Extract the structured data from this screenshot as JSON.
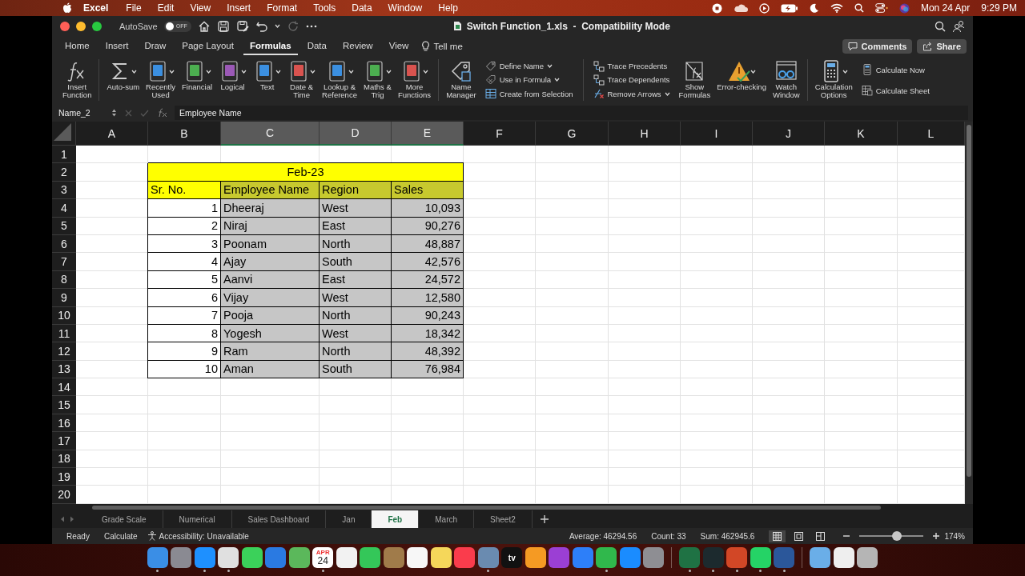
{
  "menu_bar": {
    "app": "Excel",
    "items": [
      "File",
      "Edit",
      "View",
      "Insert",
      "Format",
      "Tools",
      "Data",
      "Window",
      "Help"
    ],
    "date": "Mon 24 Apr",
    "time": "9:29 PM"
  },
  "title_bar": {
    "autosave_label": "AutoSave",
    "autosave": {
      "on": false,
      "label": "OFF"
    },
    "title": "Switch Function_1.xls  -  Compatibility Mode"
  },
  "tabs": [
    {
      "label": "Home",
      "selected": false
    },
    {
      "label": "Insert",
      "selected": false
    },
    {
      "label": "Draw",
      "selected": false
    },
    {
      "label": "Page Layout",
      "selected": false
    },
    {
      "label": "Formulas",
      "selected": true
    },
    {
      "label": "Data",
      "selected": false
    },
    {
      "label": "Review",
      "selected": false
    },
    {
      "label": "View",
      "selected": false
    }
  ],
  "tell_me": "Tell me",
  "share_buttons": [
    {
      "kind": "comments",
      "label": "Comments"
    },
    {
      "kind": "share",
      "label": "Share"
    }
  ],
  "ribbon": {
    "groups": [
      {
        "columns": [
          [
            {
              "kind": "function",
              "label": "Insert\nFunction",
              "dropdown": false
            }
          ]
        ]
      },
      {
        "columns": [
          [
            {
              "kind": "sigma",
              "label": "Auto-sum",
              "dropdown": true
            }
          ],
          [
            {
              "kind": "book",
              "color": "#3b8fe0",
              "label": "Recently\nUsed",
              "dropdown": true
            }
          ],
          [
            {
              "kind": "book",
              "color": "#4caf50",
              "label": "Financial",
              "dropdown": true
            }
          ],
          [
            {
              "kind": "book",
              "color": "#9b59b6",
              "label": "Logical",
              "dropdown": true
            }
          ],
          [
            {
              "kind": "book",
              "color": "#3b8fe0",
              "label": "Text",
              "dropdown": true
            }
          ],
          [
            {
              "kind": "book",
              "color": "#d9534f",
              "label": "Date &\nTime",
              "dropdown": true
            }
          ],
          [
            {
              "kind": "book",
              "color": "#3b8fe0",
              "label": "Lookup &\nReference",
              "dropdown": true
            }
          ],
          [
            {
              "kind": "book",
              "color": "#4caf50",
              "label": "Maths &\nTrig",
              "dropdown": true
            }
          ],
          [
            {
              "kind": "book",
              "color": "#d9534f",
              "label": "More\nFunctions",
              "dropdown": true
            }
          ]
        ]
      },
      {
        "columns": [
          [
            {
              "kind": "tag",
              "label": "Name\nManager",
              "dropdown": false
            }
          ],
          [
            {
              "kind": "tag",
              "label": "Define Name",
              "dropdown": true
            },
            {
              "kind": "formula_tag",
              "label": "Use in Formula",
              "dropdown": true
            },
            {
              "kind": "table",
              "label": "Create from Selection",
              "dropdown": false
            }
          ]
        ]
      },
      {
        "columns": [
          [
            {
              "kind": "trace",
              "label": "Trace Precedents",
              "dropdown": false
            },
            {
              "kind": "trace",
              "label": "Trace Dependents",
              "dropdown": false
            },
            {
              "kind": "remove_arrows",
              "label": "Remove Arrows",
              "dropdown": true
            }
          ],
          [
            {
              "kind": "page",
              "label": "Show\nFormulas",
              "dropdown": false
            }
          ],
          [
            {
              "kind": "warning",
              "label": "Error-checking",
              "dropdown": true
            }
          ],
          [
            {
              "kind": "glasses",
              "label": "Watch\nWindow",
              "dropdown": false
            }
          ]
        ]
      },
      {
        "columns": [
          [
            {
              "kind": "calculator",
              "label": "Calculation\nOptions",
              "dropdown": true
            }
          ],
          [
            {
              "kind": "calculator",
              "label": "Calculate Now",
              "dropdown": false
            },
            {
              "kind": "sheet",
              "label": "Calculate Sheet",
              "dropdown": false
            }
          ]
        ]
      }
    ]
  },
  "formula_bar": {
    "name_box": "Name_2",
    "content": "Employee Name"
  },
  "grid": {
    "columns": [
      {
        "label": "A",
        "selected": false
      },
      {
        "label": "B",
        "selected": false
      },
      {
        "label": "C",
        "selected": true
      },
      {
        "label": "D",
        "selected": true
      },
      {
        "label": "E",
        "selected": true
      },
      {
        "label": "F",
        "selected": false
      },
      {
        "label": "G",
        "selected": false
      },
      {
        "label": "H",
        "selected": false
      },
      {
        "label": "I",
        "selected": false
      },
      {
        "label": "J",
        "selected": false
      },
      {
        "label": "K",
        "selected": false
      },
      {
        "label": "L",
        "selected": false
      }
    ],
    "rows": [
      "1",
      "2",
      "3",
      "4",
      "5",
      "6",
      "7",
      "8",
      "9",
      "10",
      "11",
      "12",
      "13",
      "14",
      "15",
      "16",
      "17",
      "18",
      "19",
      "20"
    ]
  },
  "table": {
    "title": "Feb-23",
    "columns": [
      {
        "label": "Sr. No.",
        "selected": false
      },
      {
        "label": "Employee Name",
        "selected": true
      },
      {
        "label": "Region",
        "selected": true
      },
      {
        "label": "Sales",
        "selected": true
      }
    ],
    "rows": [
      [
        "1",
        "Dheeraj",
        "West",
        "10,093"
      ],
      [
        "2",
        "Niraj",
        "East",
        "90,276"
      ],
      [
        "3",
        "Poonam",
        "North",
        "48,887"
      ],
      [
        "4",
        "Ajay",
        "South",
        "42,576"
      ],
      [
        "5",
        "Aanvi",
        "East",
        "24,572"
      ],
      [
        "6",
        "Vijay",
        "West",
        "12,580"
      ],
      [
        "7",
        "Pooja",
        "North",
        "90,243"
      ],
      [
        "8",
        "Yogesh",
        "West",
        "18,342"
      ],
      [
        "9",
        "Ram",
        "North",
        "48,392"
      ],
      [
        "10",
        "Aman",
        "South",
        "76,984"
      ]
    ]
  },
  "sheets": [
    {
      "label": "Grade Scale",
      "selected": false
    },
    {
      "label": "Numerical",
      "selected": false
    },
    {
      "label": "Sales Dashboard",
      "selected": false
    },
    {
      "label": "Jan",
      "selected": false
    },
    {
      "label": "Feb",
      "selected": true
    },
    {
      "label": "March",
      "selected": false
    },
    {
      "label": "Sheet2",
      "selected": false
    }
  ],
  "status_bar": {
    "mode": "Ready",
    "calculate": "Calculate",
    "accessibility": "Accessibility: Unavailable",
    "average": "Average: 46294.56",
    "count": "Count: 33",
    "sum": "Sum: 462945.6",
    "views": [
      {
        "kind": "normal",
        "selected": true
      },
      {
        "kind": "page_layout",
        "selected": false
      },
      {
        "kind": "page_break",
        "selected": false
      }
    ],
    "zoom": {
      "level": 0.58,
      "label": "174%"
    }
  },
  "dock": [
    {
      "kind": "app",
      "color": "#3a8ee6",
      "running": true
    },
    {
      "kind": "app",
      "color": "#8a8a92",
      "running": false
    },
    {
      "kind": "app",
      "color": "#1e90ff",
      "running": true
    },
    {
      "kind": "app",
      "color": "#e0e0e0",
      "running": true
    },
    {
      "kind": "app",
      "color": "#3bd15a",
      "running": false
    },
    {
      "kind": "app",
      "color": "#2a7ae2",
      "running": false
    },
    {
      "kind": "app",
      "color": "#5bb85b",
      "running": false
    },
    {
      "kind": "calendar",
      "color": "#ffffff",
      "running": true,
      "month": "APR",
      "day": "24"
    },
    {
      "kind": "app",
      "color": "#f2f2f2",
      "running": false
    },
    {
      "kind": "app",
      "color": "#34c759",
      "running": false
    },
    {
      "kind": "app",
      "color": "#a07b4a",
      "running": false
    },
    {
      "kind": "app",
      "color": "#f7f7f7",
      "running": false
    },
    {
      "kind": "app",
      "color": "#f5d75a",
      "running": false
    },
    {
      "kind": "app",
      "color": "#fa3c4c",
      "running": false
    },
    {
      "kind": "app",
      "color": "#6a8bb0",
      "running": true
    },
    {
      "kind": "tv",
      "color": "#111111",
      "running": false,
      "label": "tv"
    },
    {
      "kind": "app",
      "color": "#f59a23",
      "running": false
    },
    {
      "kind": "app",
      "color": "#9b3fd4",
      "running": false
    },
    {
      "kind": "app",
      "color": "#2d7ff9",
      "running": false
    },
    {
      "kind": "app",
      "color": "#30b84c",
      "running": true
    },
    {
      "kind": "app",
      "color": "#1a8cff",
      "running": false
    },
    {
      "kind": "app",
      "color": "#8e8e93",
      "running": false
    },
    {
      "kind": "separator"
    },
    {
      "kind": "app",
      "color": "#1f7244",
      "running": true
    },
    {
      "kind": "app",
      "color": "#1c2a2e",
      "running": true
    },
    {
      "kind": "app",
      "color": "#d24726",
      "running": true
    },
    {
      "kind": "app",
      "color": "#25d366",
      "running": true
    },
    {
      "kind": "app",
      "color": "#2b579a",
      "running": true
    },
    {
      "kind": "separator"
    },
    {
      "kind": "app",
      "color": "#6aaee8",
      "running": false
    },
    {
      "kind": "app",
      "color": "#eeeeee",
      "running": false
    },
    {
      "kind": "app",
      "color": "#b5b5b5",
      "running": false
    }
  ]
}
